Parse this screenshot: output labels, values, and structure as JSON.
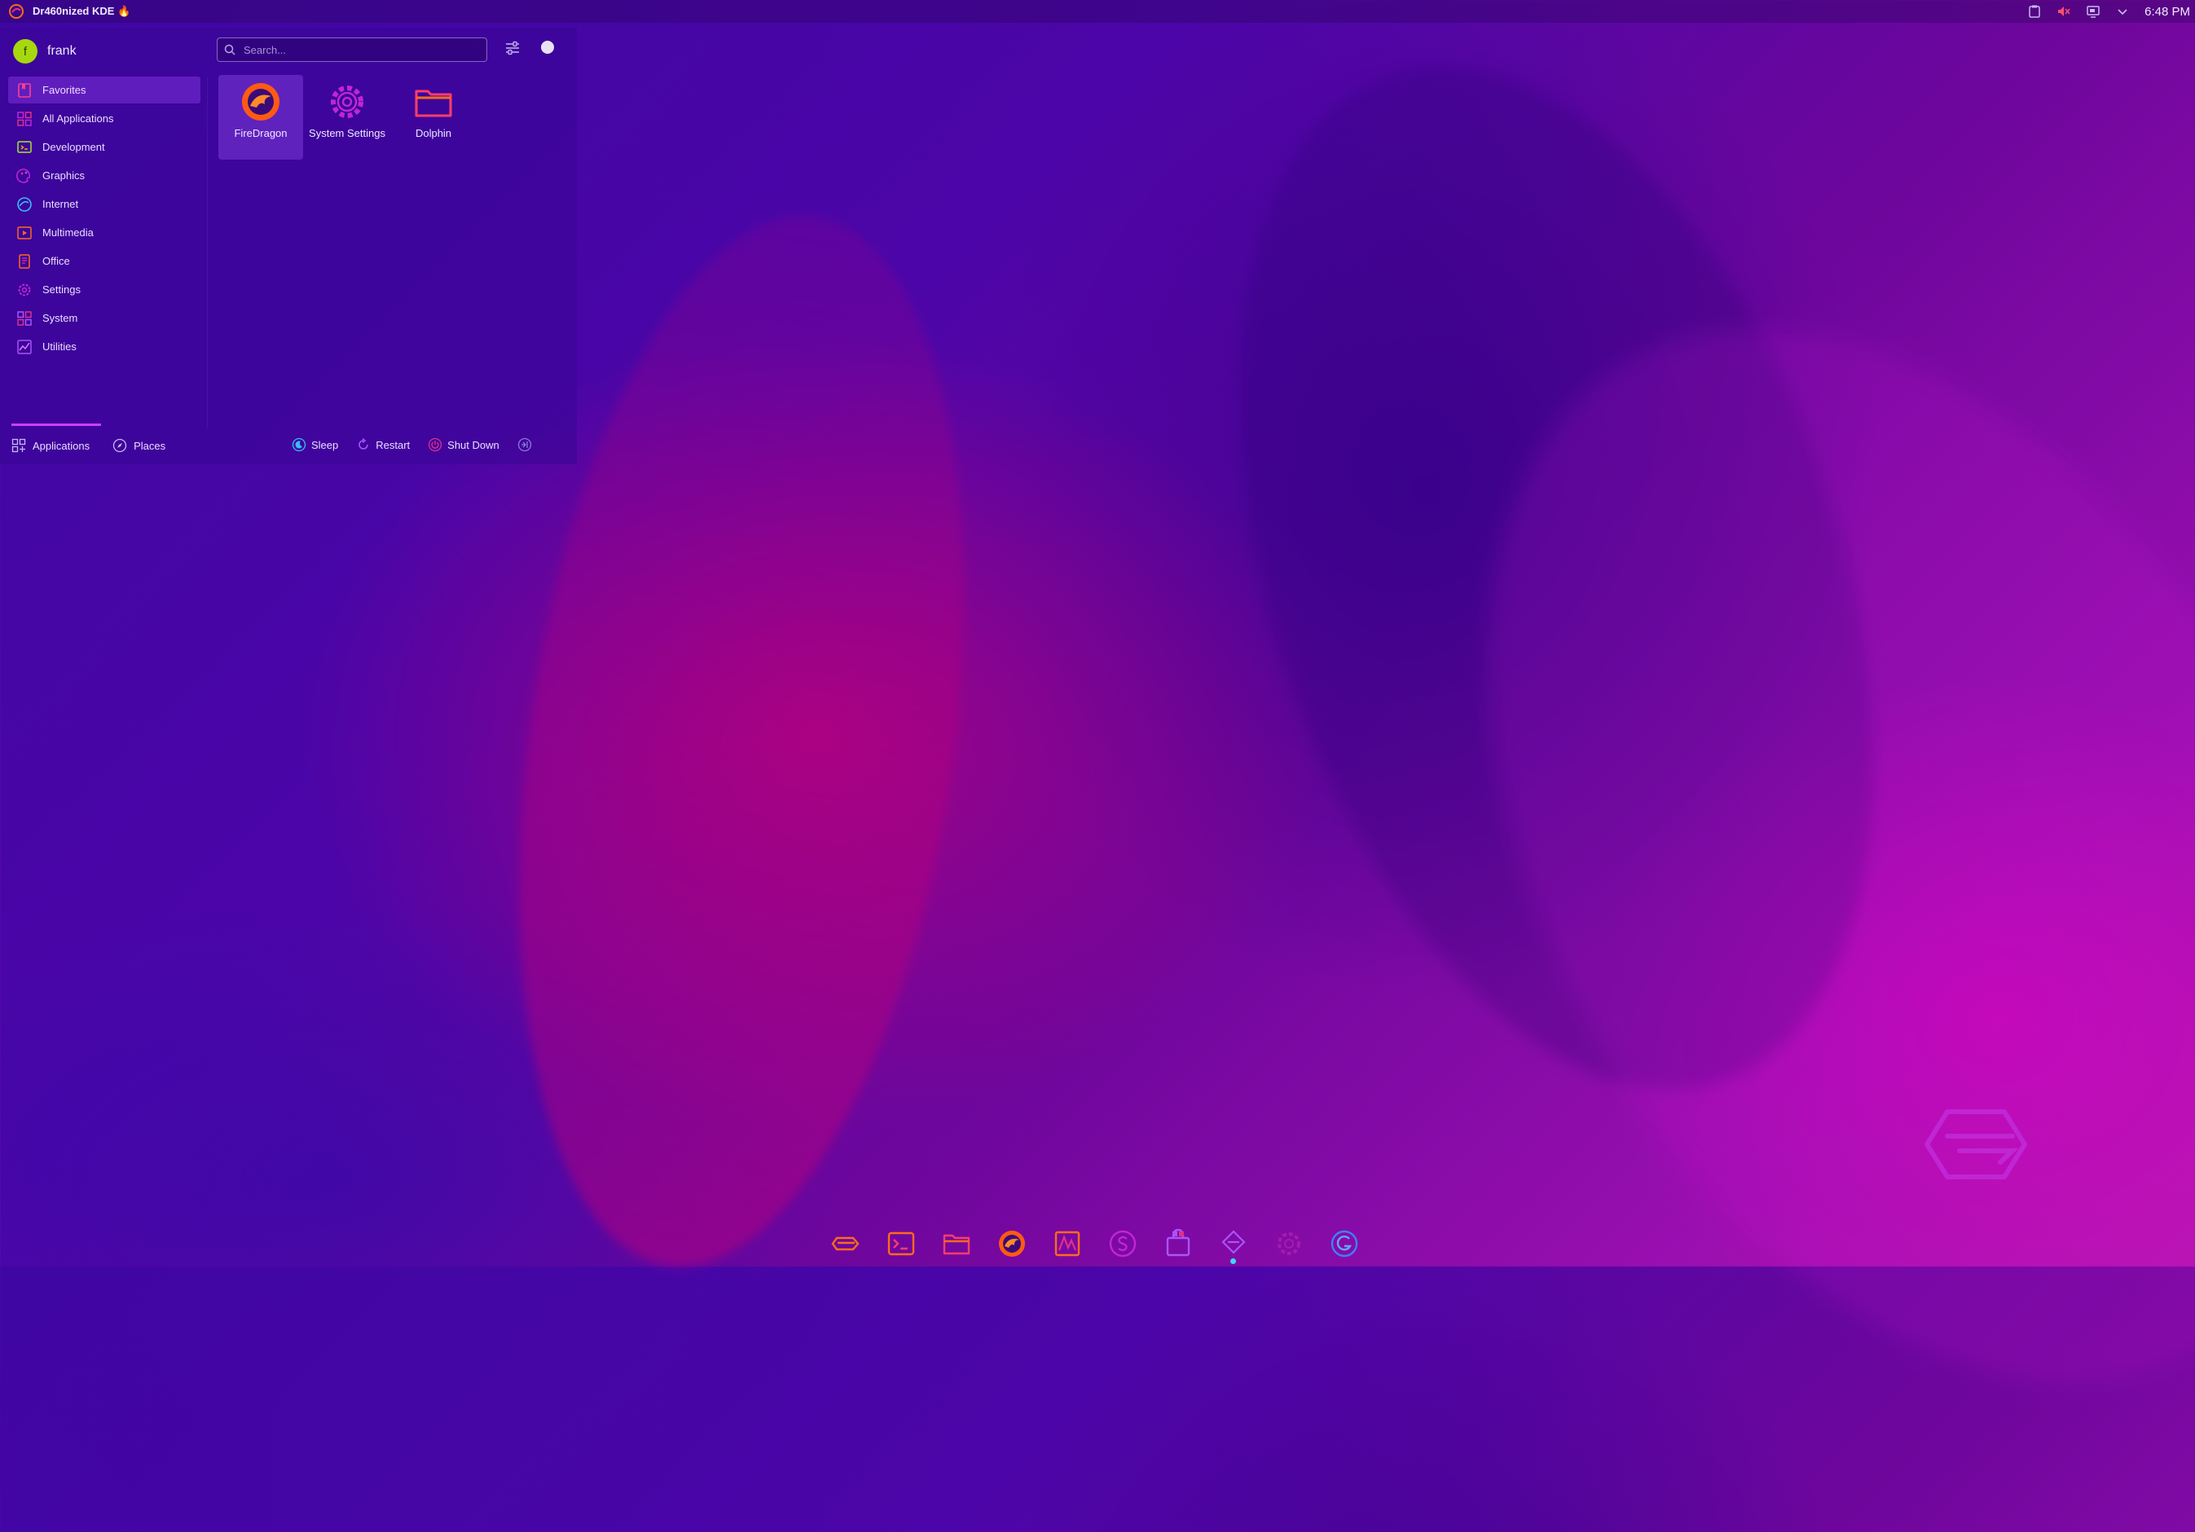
{
  "panel": {
    "distro_title": "Dr460nized KDE 🔥",
    "clock": "6:48 PM",
    "tray_icons": [
      "clipboard-icon",
      "volume-muted-icon",
      "display-icon",
      "expand-tray-icon"
    ]
  },
  "menu": {
    "user": {
      "avatar_letter": "f",
      "name": "frank"
    },
    "search": {
      "placeholder": "Search..."
    },
    "categories": [
      {
        "label": "Favorites",
        "icon": "bookmark-icon"
      },
      {
        "label": "All Applications",
        "icon": "grid-icon"
      },
      {
        "label": "Development",
        "icon": "development-icon"
      },
      {
        "label": "Graphics",
        "icon": "graphics-icon"
      },
      {
        "label": "Internet",
        "icon": "internet-icon"
      },
      {
        "label": "Multimedia",
        "icon": "multimedia-icon"
      },
      {
        "label": "Office",
        "icon": "office-icon"
      },
      {
        "label": "Settings",
        "icon": "settings-icon"
      },
      {
        "label": "System",
        "icon": "system-icon"
      },
      {
        "label": "Utilities",
        "icon": "utilities-icon"
      }
    ],
    "favorites": [
      {
        "label": "FireDragon",
        "icon": "firedragon-icon"
      },
      {
        "label": "System Settings",
        "icon": "system-settings-icon"
      },
      {
        "label": "Dolphin",
        "icon": "folder-icon"
      }
    ],
    "tabs": [
      {
        "label": "Applications"
      },
      {
        "label": "Places"
      }
    ],
    "power": {
      "sleep": "Sleep",
      "restart": "Restart",
      "shutdown": "Shut Down"
    }
  },
  "dock": [
    "garuda-icon",
    "terminal-icon",
    "folder-icon",
    "firedragon-icon",
    "system-monitor-icon",
    "snapshot-icon",
    "software-store-icon",
    "assistant-icon",
    "settings-gear-icon",
    "garuda-welcome-icon"
  ],
  "colors": {
    "accent_pink": "#e0308a",
    "accent_magenta": "#c026d3",
    "accent_purple": "#a855f7",
    "accent_orange": "#ff6a1a",
    "accent_cyan": "#3fd6ff"
  }
}
